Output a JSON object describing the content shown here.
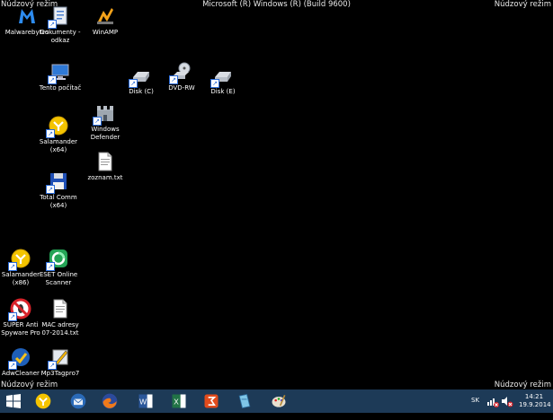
{
  "overlay": {
    "safe_mode_tl": "Núdzový režim",
    "safe_mode_tr": "Núdzový režim",
    "safe_mode_bl": "Núdzový režim",
    "safe_mode_br": "Núdzový režim",
    "build": "Microsoft (R) Windows (R) (Build 9600)"
  },
  "desktop": {
    "malwarebytes": "Malwarebytes",
    "dokumenty": "Dokumenty - odkaz",
    "winamp": "WinAMP",
    "tento_pocitac": "Tento počítač",
    "disk_c": "Disk (C)",
    "dvd_rw": "DVD-RW",
    "disk_e": "Disk (E)",
    "salamander64": "Salamander (x64)",
    "windows_defender": "Windows Defender",
    "zoznam": "zoznam.txt",
    "total_comm": "Total Comm (x64)",
    "salamander86": "Salamander (x86)",
    "eset": "ESET Online Scanner",
    "super_anti": "SUPER Anti Spyware Pro",
    "mac_adresy": "MAC adresy 07-2014.txt",
    "adwcleaner": "AdwCleaner",
    "mp3tag": "Mp3Tagpro7"
  },
  "taskbar": {
    "lang": "SK",
    "time": "14:21",
    "date": "19.9.2014"
  },
  "colors": {
    "taskbar": "#1d3a57",
    "desktop": "#000000"
  }
}
